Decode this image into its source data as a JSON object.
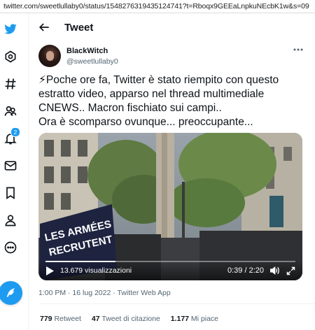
{
  "browser": {
    "url": "twitter.com/sweetlullaby0/status/1548276319435124741?t=Rboqx9GEEaLnpkuNEcbK1w&s=09"
  },
  "sidebar": {
    "items": [
      {
        "icon": "twitter-logo-icon"
      },
      {
        "icon": "explore-icon"
      },
      {
        "icon": "hashtag-icon"
      },
      {
        "icon": "communities-icon"
      },
      {
        "icon": "notifications-icon",
        "badge": "2"
      },
      {
        "icon": "messages-icon"
      },
      {
        "icon": "bookmark-icon"
      },
      {
        "icon": "profile-icon"
      },
      {
        "icon": "more-icon"
      }
    ],
    "compose_icon": "compose-icon"
  },
  "header": {
    "title": "Tweet"
  },
  "tweet": {
    "author_name": "BlackWitch",
    "author_handle": "@sweetlullaby0",
    "text_lines": [
      "⚡Poche ore fa, Twitter è stato riempito con questo",
      "estratto video, apparso nel thread multimediale",
      "CNEWS.. Macron fischiato sui campi..",
      "Ora è scomparso ovunque... preoccupante..."
    ],
    "video": {
      "banner_line1": "LES ARMÉES",
      "banner_line2": "RECRUTENT",
      "views": "13.679 visualizzazioni",
      "time": "0:39 / 2:20",
      "progress": 0.28
    },
    "time_text": "1:00 PM · 16 lug 2022 · ",
    "client": "Twitter Web App",
    "stats": {
      "retweets": "779",
      "retweets_label": "Retweet",
      "quotes": "47",
      "quotes_label": "Tweet di citazione",
      "likes": "1.177",
      "likes_label": "Mi piace"
    }
  },
  "colors": {
    "accent": "#1d9bf0",
    "text": "#0f1419",
    "secondary": "#536471"
  }
}
